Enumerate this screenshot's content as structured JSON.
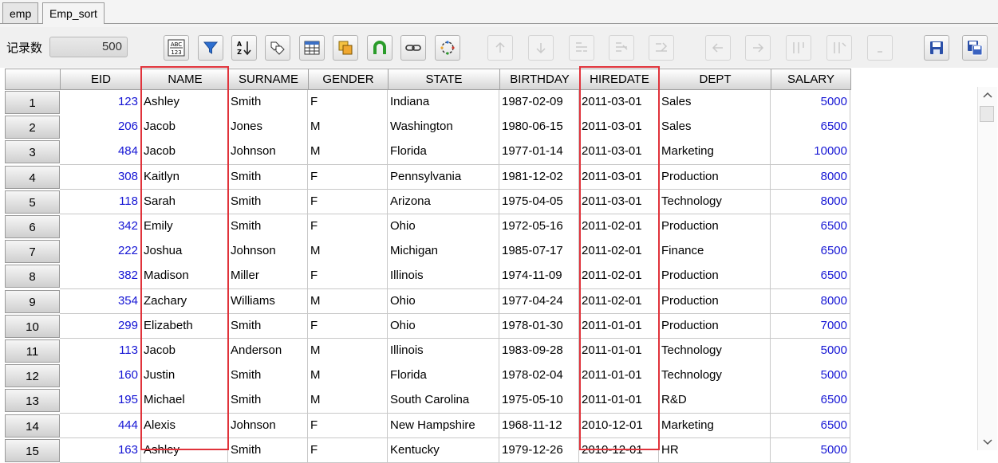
{
  "tabs": [
    {
      "label": "emp",
      "active": false
    },
    {
      "label": "Emp_sort",
      "active": true
    }
  ],
  "toolbar": {
    "record_label": "记录数",
    "record_count": "500"
  },
  "table": {
    "columns": [
      "EID",
      "NAME",
      "SURNAME",
      "GENDER",
      "STATE",
      "BIRTHDAY",
      "HIREDATE",
      "DEPT",
      "SALARY"
    ],
    "rows": [
      {
        "n": "1",
        "cells": [
          "123",
          "Ashley",
          "Smith",
          "F",
          "Indiana",
          "1987-02-09",
          "2011-03-01",
          "Sales",
          "5000"
        ]
      },
      {
        "n": "2",
        "cells": [
          "206",
          "Jacob",
          "Jones",
          "M",
          "Washington",
          "1980-06-15",
          "2011-03-01",
          "Sales",
          "6500"
        ]
      },
      {
        "n": "3",
        "cells": [
          "484",
          "Jacob",
          "Johnson",
          "M",
          "Florida",
          "1977-01-14",
          "2011-03-01",
          "Marketing",
          "10000"
        ]
      },
      {
        "n": "4",
        "cells": [
          "308",
          "Kaitlyn",
          "Smith",
          "F",
          "Pennsylvania",
          "1981-12-02",
          "2011-03-01",
          "Production",
          "8000"
        ]
      },
      {
        "n": "5",
        "cells": [
          "118",
          "Sarah",
          "Smith",
          "F",
          "Arizona",
          "1975-04-05",
          "2011-03-01",
          "Technology",
          "8000"
        ]
      },
      {
        "n": "6",
        "cells": [
          "342",
          "Emily",
          "Smith",
          "F",
          "Ohio",
          "1972-05-16",
          "2011-02-01",
          "Production",
          "6500"
        ]
      },
      {
        "n": "7",
        "cells": [
          "222",
          "Joshua",
          "Johnson",
          "M",
          "Michigan",
          "1985-07-17",
          "2011-02-01",
          "Finance",
          "6500"
        ]
      },
      {
        "n": "8",
        "cells": [
          "382",
          "Madison",
          "Miller",
          "F",
          "Illinois",
          "1974-11-09",
          "2011-02-01",
          "Production",
          "6500"
        ]
      },
      {
        "n": "9",
        "cells": [
          "354",
          "Zachary",
          "Williams",
          "M",
          "Ohio",
          "1977-04-24",
          "2011-02-01",
          "Production",
          "8000"
        ]
      },
      {
        "n": "10",
        "cells": [
          "299",
          "Elizabeth",
          "Smith",
          "F",
          "Ohio",
          "1978-01-30",
          "2011-01-01",
          "Production",
          "7000"
        ]
      },
      {
        "n": "11",
        "cells": [
          "113",
          "Jacob",
          "Anderson",
          "M",
          "Illinois",
          "1983-09-28",
          "2011-01-01",
          "Technology",
          "5000"
        ]
      },
      {
        "n": "12",
        "cells": [
          "160",
          "Justin",
          "Smith",
          "M",
          "Florida",
          "1978-02-04",
          "2011-01-01",
          "Technology",
          "5000"
        ]
      },
      {
        "n": "13",
        "cells": [
          "195",
          "Michael",
          "Smith",
          "M",
          "South Carolina",
          "1975-05-10",
          "2011-01-01",
          "R&D",
          "6500"
        ]
      },
      {
        "n": "14",
        "cells": [
          "444",
          "Alexis",
          "Johnson",
          "F",
          "New Hampshire",
          "1968-11-12",
          "2010-12-01",
          "Marketing",
          "6500"
        ]
      },
      {
        "n": "15",
        "cells": [
          "163",
          "Ashley",
          "Smith",
          "F",
          "Kentucky",
          "1979-12-26",
          "2010-12-01",
          "HR",
          "5000"
        ]
      }
    ]
  },
  "highlighted_columns": [
    "NAME",
    "HIREDATE"
  ],
  "colors": {
    "numeric_text": "#1515d4",
    "highlight_border": "#e0333b"
  },
  "icons": {
    "toolbar": [
      "abc-123-icon",
      "filter-icon",
      "sort-az-icon",
      "tag-copy-icon",
      "table-calc-icon",
      "copy-icon",
      "magnet-icon",
      "link-icon",
      "refresh-icon",
      "arrow-up-icon",
      "arrow-down-icon",
      "insert-row-icon",
      "delete-row-icon",
      "row-edit-icon",
      "arrow-left-icon",
      "arrow-right-icon",
      "insert-col-icon",
      "delete-col-icon",
      "more-icon",
      "save-icon",
      "save-as-icon"
    ]
  }
}
